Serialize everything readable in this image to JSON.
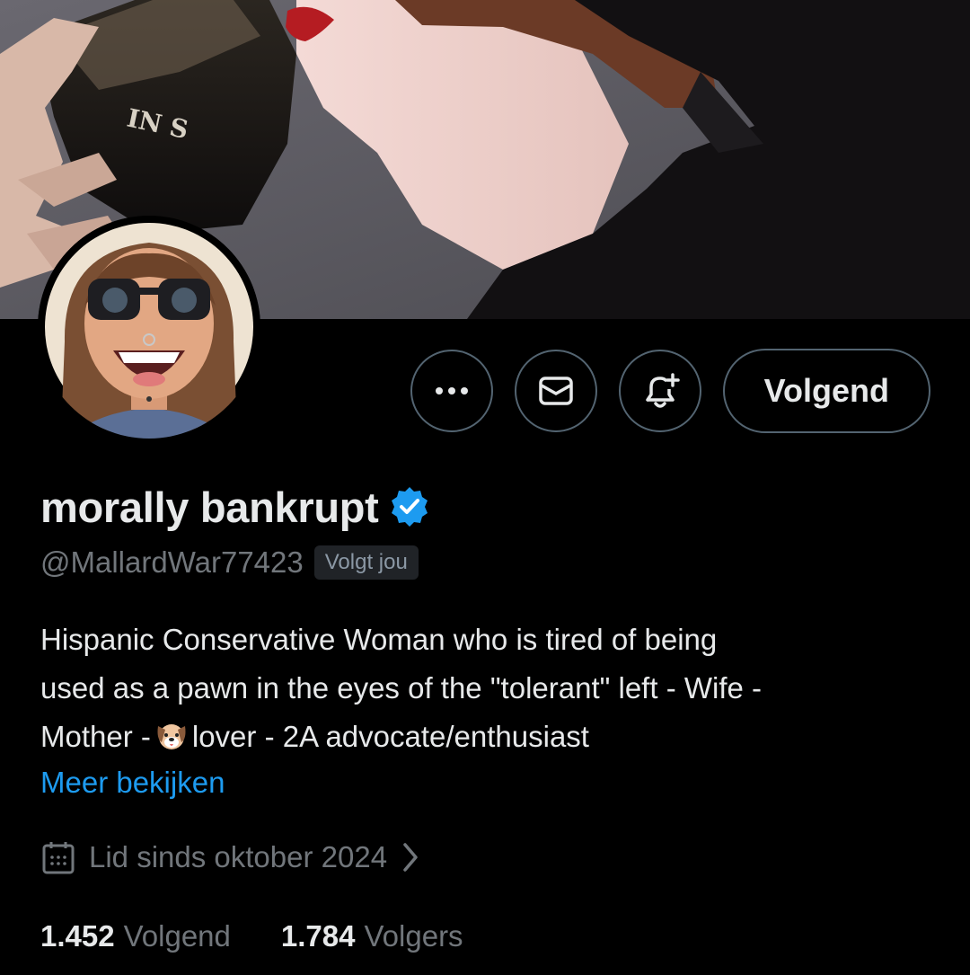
{
  "profile": {
    "display_name": "morally bankrupt",
    "verified": true,
    "handle": "@MallardWar77423",
    "follows_you_badge": "Volgt jou",
    "bio_line1": "Hispanic Conservative Woman who is tired of being",
    "bio_line2": "used as a pawn in the eyes of the \"tolerant\" left - Wife -",
    "bio_line3_before": "Mother -",
    "bio_line3_after": "lover - 2A advocate/enthusiast",
    "see_more": "Meer bekijken",
    "joined": "Lid sinds oktober 2024",
    "following_count": "1.452",
    "following_label": "Volgend",
    "followers_count": "1.784",
    "followers_label": "Volgers"
  },
  "actions": {
    "more_icon": "more-horizontal-icon",
    "message_icon": "envelope-icon",
    "notify_icon": "bell-plus-icon",
    "follow_button_label": "Volgend"
  },
  "banner": {
    "glass_text": "IN  S"
  },
  "colors": {
    "background": "#000000",
    "primary_text": "#e7e9ea",
    "secondary_text": "#71767b",
    "accent": "#1d9bf0",
    "button_border": "#536471",
    "badge_bg": "#202327"
  },
  "icons": {
    "verified": "verified-badge-icon",
    "calendar": "calendar-icon",
    "chevron": "chevron-right-icon",
    "bio_emoji": "dog-face-emoji"
  }
}
